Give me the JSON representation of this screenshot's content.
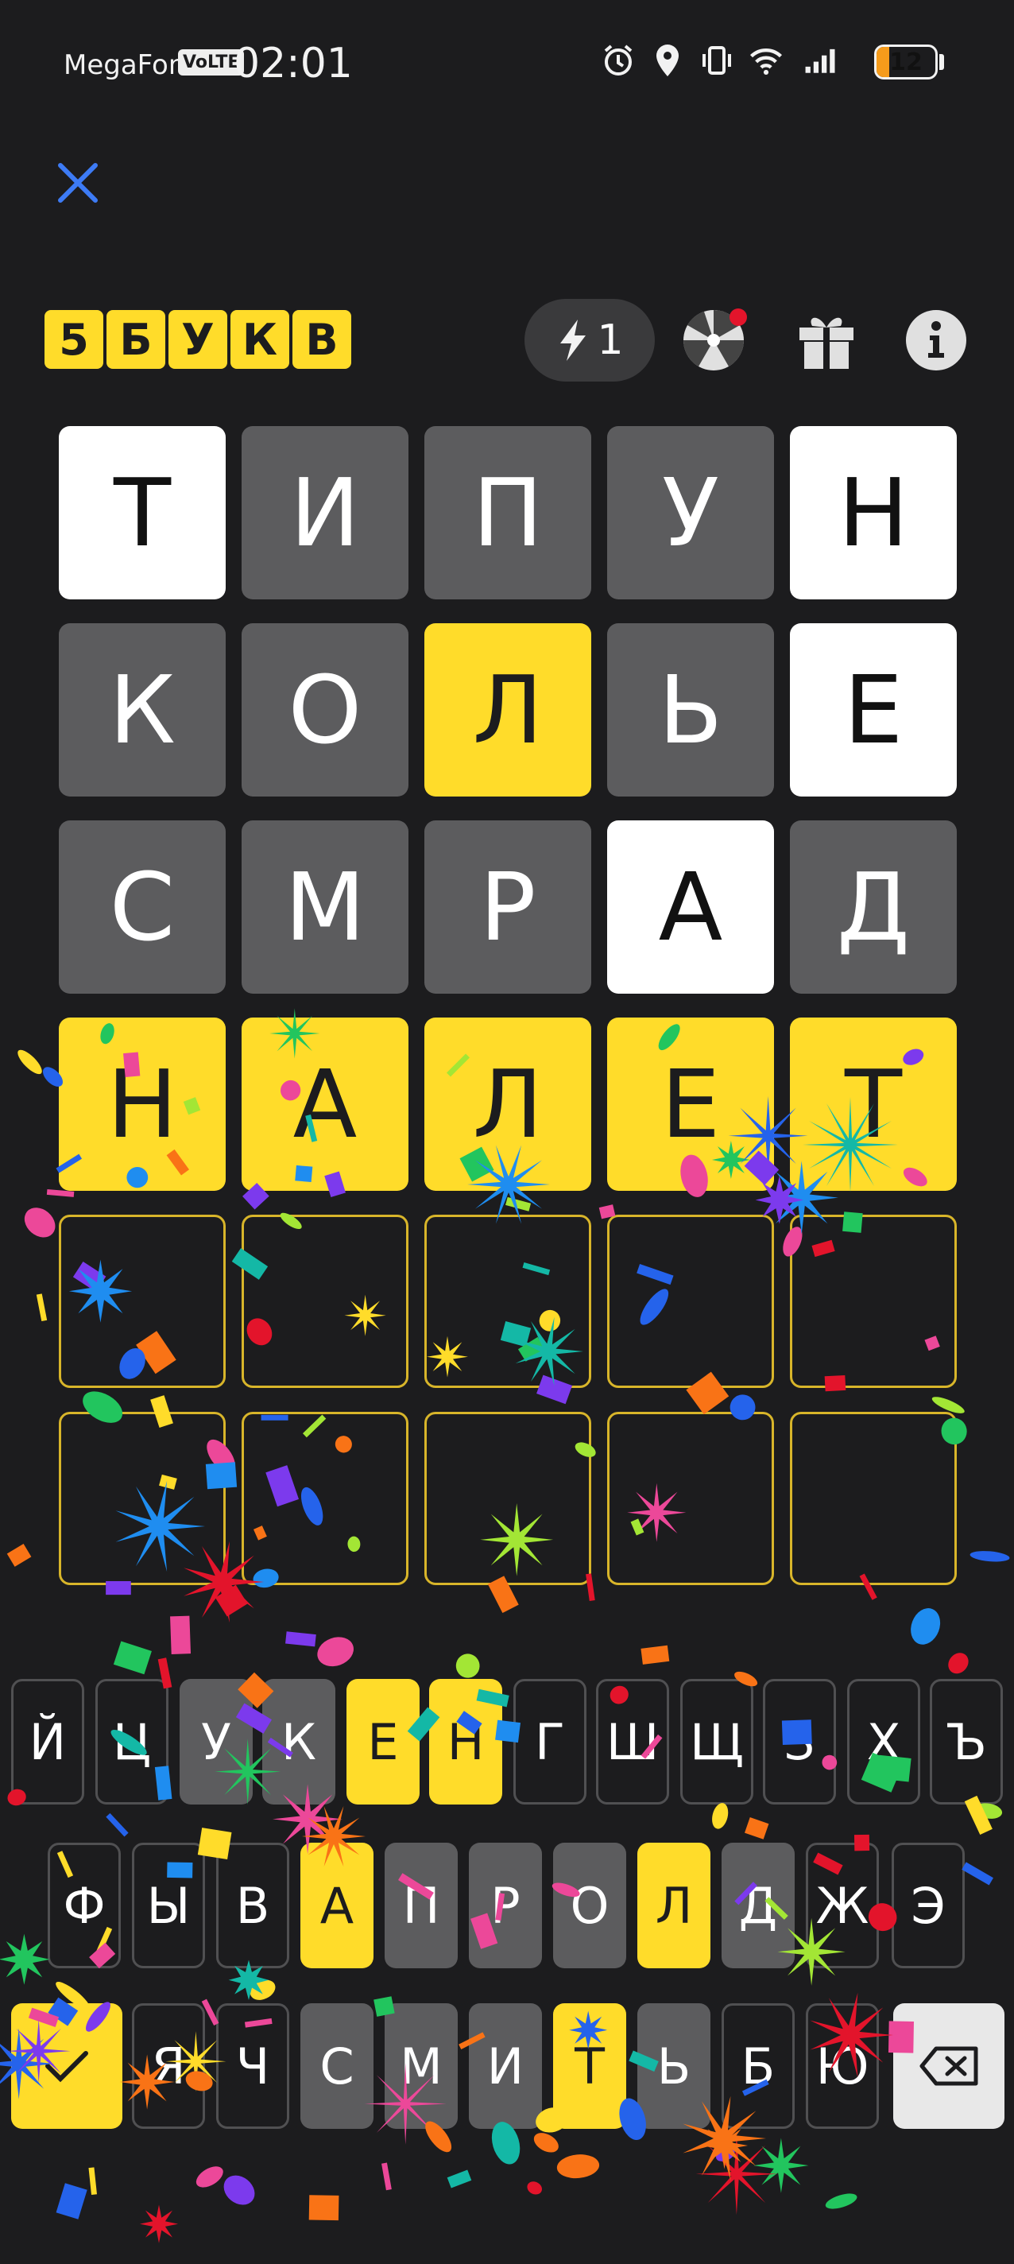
{
  "status_bar": {
    "carrier": "MegaFon",
    "volte": "VoLTE",
    "time": "02:01",
    "battery": "12",
    "battery_level": 0.12,
    "icons": [
      "alarm-icon",
      "location-icon",
      "vibrate-icon",
      "wifi-icon",
      "signal-icon"
    ]
  },
  "header": {
    "close_icon": "close-icon",
    "logo_letters": [
      "5",
      "Б",
      "У",
      "К",
      "В"
    ],
    "hints_count": "1",
    "hint_icon": "lightning-icon",
    "wheel_icon": "wheel-icon",
    "gift_icon": "gift-icon",
    "info_icon": "info-icon"
  },
  "colors": {
    "background": "#1c1c1e",
    "yellow": "#ffdc2a",
    "gray": "#5c5c5e",
    "white": "#ffffff",
    "accent_blue": "#3d7bf5"
  },
  "board": {
    "rows": [
      [
        {
          "letter": "Т",
          "state": "white"
        },
        {
          "letter": "И",
          "state": "gray"
        },
        {
          "letter": "П",
          "state": "gray"
        },
        {
          "letter": "У",
          "state": "gray"
        },
        {
          "letter": "Н",
          "state": "white"
        }
      ],
      [
        {
          "letter": "К",
          "state": "gray"
        },
        {
          "letter": "О",
          "state": "gray"
        },
        {
          "letter": "Л",
          "state": "yellow"
        },
        {
          "letter": "Ь",
          "state": "gray"
        },
        {
          "letter": "Е",
          "state": "white"
        }
      ],
      [
        {
          "letter": "С",
          "state": "gray"
        },
        {
          "letter": "М",
          "state": "gray"
        },
        {
          "letter": "Р",
          "state": "gray"
        },
        {
          "letter": "А",
          "state": "white"
        },
        {
          "letter": "Д",
          "state": "gray"
        }
      ],
      [
        {
          "letter": "Н",
          "state": "yellow"
        },
        {
          "letter": "А",
          "state": "yellow"
        },
        {
          "letter": "Л",
          "state": "yellow"
        },
        {
          "letter": "Е",
          "state": "yellow"
        },
        {
          "letter": "Т",
          "state": "yellow"
        }
      ],
      [
        {
          "letter": "",
          "state": "empty"
        },
        {
          "letter": "",
          "state": "empty"
        },
        {
          "letter": "",
          "state": "empty"
        },
        {
          "letter": "",
          "state": "empty"
        },
        {
          "letter": "",
          "state": "empty"
        }
      ],
      [
        {
          "letter": "",
          "state": "empty"
        },
        {
          "letter": "",
          "state": "empty"
        },
        {
          "letter": "",
          "state": "empty"
        },
        {
          "letter": "",
          "state": "empty"
        },
        {
          "letter": "",
          "state": "empty"
        }
      ]
    ]
  },
  "keyboard": {
    "rows": [
      [
        {
          "k": "Й",
          "s": "unused"
        },
        {
          "k": "Ц",
          "s": "unused"
        },
        {
          "k": "У",
          "s": "gray"
        },
        {
          "k": "К",
          "s": "gray"
        },
        {
          "k": "Е",
          "s": "yellow"
        },
        {
          "k": "Н",
          "s": "yellow"
        },
        {
          "k": "Г",
          "s": "unused"
        },
        {
          "k": "Ш",
          "s": "unused"
        },
        {
          "k": "Щ",
          "s": "unused"
        },
        {
          "k": "З",
          "s": "unused"
        },
        {
          "k": "Х",
          "s": "unused"
        },
        {
          "k": "Ъ",
          "s": "unused"
        }
      ],
      [
        {
          "k": "Ф",
          "s": "unused"
        },
        {
          "k": "Ы",
          "s": "unused"
        },
        {
          "k": "В",
          "s": "unused"
        },
        {
          "k": "А",
          "s": "yellow"
        },
        {
          "k": "П",
          "s": "gray"
        },
        {
          "k": "Р",
          "s": "gray"
        },
        {
          "k": "О",
          "s": "gray"
        },
        {
          "k": "Л",
          "s": "yellow"
        },
        {
          "k": "Д",
          "s": "gray"
        },
        {
          "k": "Ж",
          "s": "unused"
        },
        {
          "k": "Э",
          "s": "unused"
        }
      ],
      [
        {
          "k": "✓",
          "s": "yellow"
        },
        {
          "k": "Я",
          "s": "unused"
        },
        {
          "k": "Ч",
          "s": "unused"
        },
        {
          "k": "С",
          "s": "gray"
        },
        {
          "k": "М",
          "s": "gray"
        },
        {
          "k": "И",
          "s": "gray"
        },
        {
          "k": "Т",
          "s": "yellow"
        },
        {
          "k": "Ь",
          "s": "gray"
        },
        {
          "k": "Б",
          "s": "unused"
        },
        {
          "k": "Ю",
          "s": "unused"
        },
        {
          "k": "⌫",
          "s": "light"
        }
      ]
    ],
    "enter_icon": "check-icon",
    "backspace_icon": "backspace-icon"
  }
}
